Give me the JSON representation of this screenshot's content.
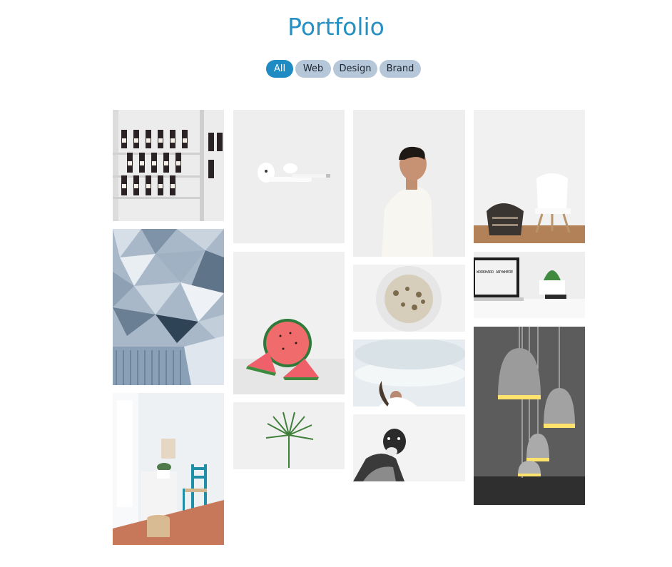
{
  "page": {
    "title": "Portfolio"
  },
  "filters": [
    {
      "label": "All",
      "active": true
    },
    {
      "label": "Web",
      "active": false
    },
    {
      "label": "Design",
      "active": false
    },
    {
      "label": "Brand",
      "active": false
    }
  ],
  "colors": {
    "title": "#2590c4",
    "filter_active": "#1f8bc3",
    "filter_inactive": "#b5c7d8"
  },
  "photos": {
    "laptop_screen_text": "WORKHARD ANYWHERE"
  }
}
